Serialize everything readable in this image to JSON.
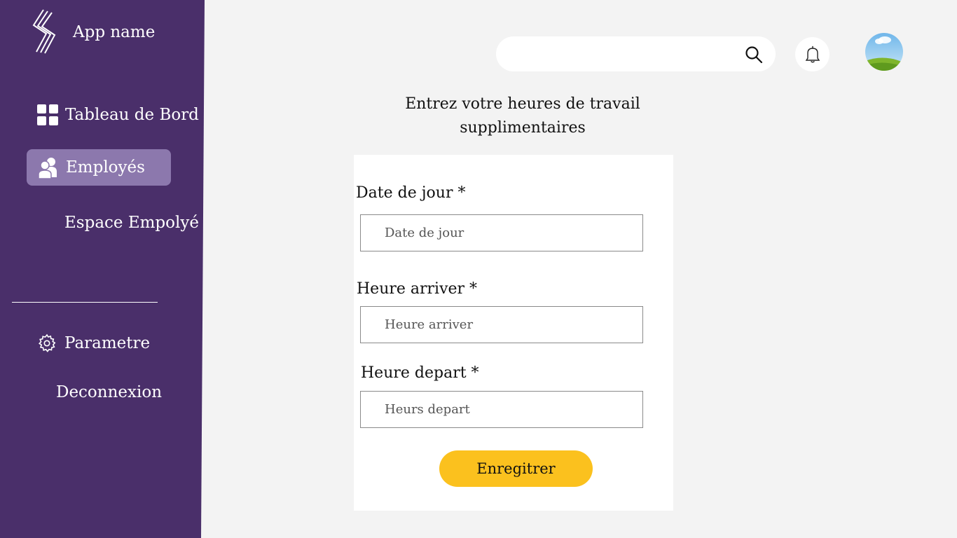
{
  "app": {
    "name": "App name"
  },
  "sidebar": {
    "items": [
      {
        "label": "Tableau de Bord",
        "icon": "dashboard-grid-icon"
      },
      {
        "label": "Employés",
        "icon": "users-icon",
        "active": true
      },
      {
        "label": "Espace Empolyé"
      },
      {
        "label": "Parametre",
        "icon": "gear-icon"
      },
      {
        "label": "Deconnexion"
      }
    ],
    "active_color": "#8c78ad",
    "background": "#4a2f6a"
  },
  "header": {
    "search": {
      "placeholder": "",
      "icon": "search-icon"
    },
    "notifications_icon": "bell-icon",
    "avatar": "avatar-landscape"
  },
  "form": {
    "title": "Entrez votre heures de travail supplimentaires",
    "fields": [
      {
        "label": "Date de jour *",
        "placeholder": "Date de jour"
      },
      {
        "label": "Heure arriver *",
        "placeholder": "Heure arriver"
      },
      {
        "label": "Heure depart *",
        "placeholder": "Heurs depart"
      }
    ],
    "submit_label": "Enregitrer",
    "submit_color": "#fbc11e"
  }
}
